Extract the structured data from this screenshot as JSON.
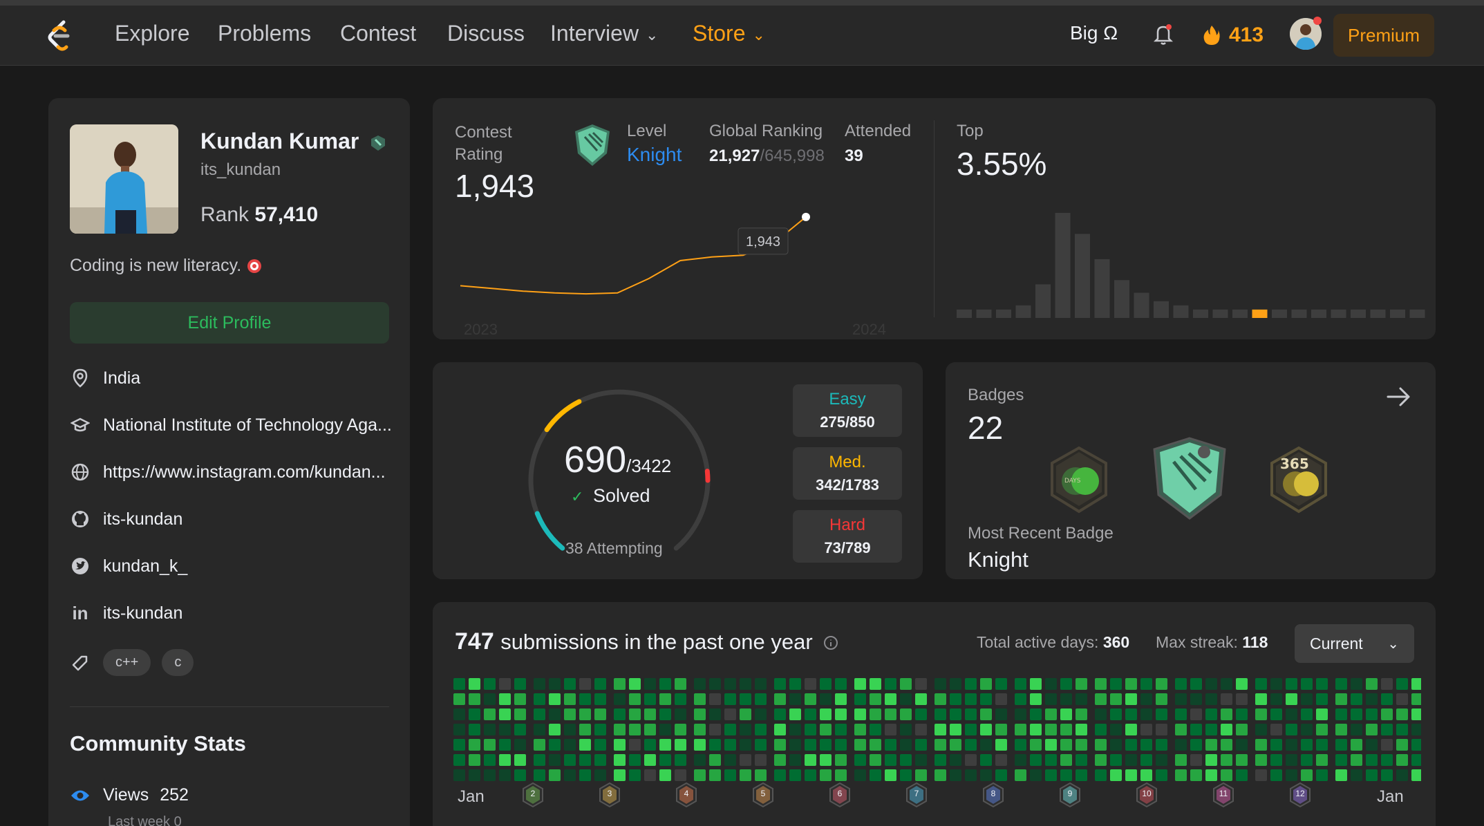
{
  "nav": {
    "items": [
      {
        "label": "Explore",
        "name": "nav-explore",
        "left": 166
      },
      {
        "label": "Problems",
        "name": "nav-problems",
        "left": 315
      },
      {
        "label": "Contest",
        "name": "nav-contest",
        "left": 492
      },
      {
        "label": "Discuss",
        "name": "nav-discuss",
        "left": 647
      }
    ],
    "interview": "Interview",
    "store": "Store",
    "big_o": "Big Ω",
    "streak": "413",
    "premium": "Premium"
  },
  "profile": {
    "name": "Kundan Kumar",
    "handle": "its_kundan",
    "rank_label": "Rank",
    "rank": "57,410",
    "bio": "Coding is new literacy.",
    "edit_profile": "Edit Profile",
    "location": "India",
    "school": "National Institute of Technology Aga...",
    "website": "https://www.instagram.com/kundan...",
    "github": "its-kundan",
    "twitter": "kundan_k_",
    "linkedin": "its-kundan",
    "skills": [
      "c++",
      "c"
    ],
    "community_title": "Community Stats",
    "views_label": "Views",
    "views": "252",
    "last_week": "Last week 0"
  },
  "contest": {
    "rating_label_1": "Contest",
    "rating_label_2": "Rating",
    "rating": "1,943",
    "level_label": "Level",
    "level": "Knight",
    "global_label": "Global Ranking",
    "global_rank": "21,927",
    "global_total": "/645,998",
    "attended_label": "Attended",
    "attended": "39",
    "top_label": "Top",
    "top_pct": "3.55%",
    "tooltip": "1,943",
    "year_start": "2023",
    "year_end": "2024"
  },
  "solved": {
    "count": "690",
    "total": "/3422",
    "solved_label": "Solved",
    "attempting": "38 Attempting",
    "easy_label": "Easy",
    "easy": "275/850",
    "med_label": "Med.",
    "med": "342/1783",
    "hard_label": "Hard",
    "hard": "73/789"
  },
  "badges": {
    "label": "Badges",
    "count": "22",
    "recent_label": "Most Recent Badge",
    "recent": "Knight"
  },
  "submissions": {
    "count": "747",
    "text": "submissions in the past one year",
    "active_label": "Total active days:",
    "active_days": "360",
    "streak_label": "Max streak:",
    "max_streak": "118",
    "period": "Current",
    "month_start": "Jan",
    "month_end": "Jan",
    "month_badges": [
      "2",
      "3",
      "4",
      "5",
      "6",
      "7",
      "8",
      "9",
      "10",
      "11",
      "12"
    ]
  },
  "colors": {
    "accent": "#ffa116",
    "easy": "#1cbaba",
    "medium": "#ffb700",
    "hard": "#f63737",
    "green": "#2cbb5d",
    "knight_blue": "#2d8cf0"
  },
  "chart_data": [
    {
      "type": "line",
      "title": "Contest Rating",
      "x": [
        "2023",
        "2024"
      ],
      "series": [
        {
          "values": [
            1560,
            1545,
            1530,
            1520,
            1515,
            1520,
            1600,
            1700,
            1720,
            1730,
            1800,
            1943
          ]
        }
      ]
    },
    {
      "type": "bar",
      "title": "Top",
      "values": [
        2,
        2,
        2,
        3,
        8,
        25,
        20,
        14,
        9,
        6,
        4,
        3,
        2,
        2,
        2,
        2,
        2,
        2,
        2,
        2,
        2,
        2,
        2,
        2
      ],
      "highlight_index": 15
    }
  ]
}
